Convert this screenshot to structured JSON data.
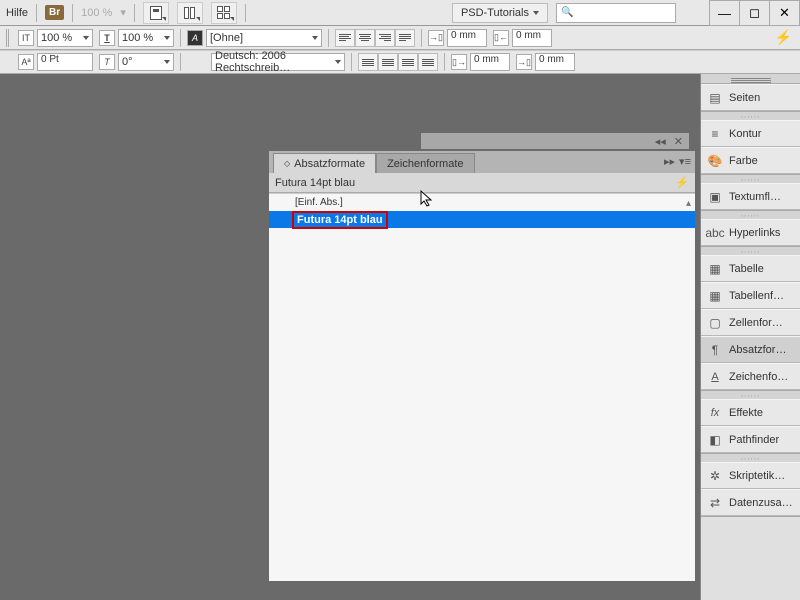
{
  "topbar": {
    "help": "Hilfe",
    "br": "Br",
    "zoom": "100 %",
    "workspace": "PSD-Tutorials",
    "search_placeholder": "🔍"
  },
  "window": {
    "min": "—",
    "max": "◻",
    "close": "✕"
  },
  "ctrl": {
    "horiz_scale": "100 %",
    "vert_scale": "100 %",
    "char_style": "[Ohne]",
    "language": "Deutsch: 2006 Rechtschreib…",
    "baseline": "0 Pt",
    "skew": "0°",
    "indent_left": "0 mm",
    "indent_right": "0 mm",
    "space_before": "0 mm",
    "space_after": "0 mm"
  },
  "panels": {
    "seiten": "Seiten",
    "kontur": "Kontur",
    "farbe": "Farbe",
    "textumfl": "Textumfl…",
    "hyperlinks": "Hyperlinks",
    "tabelle": "Tabelle",
    "tabellenf": "Tabellenf…",
    "zellenfor": "Zellenfor…",
    "absatzfor": "Absatzfor…",
    "zeichenfo": "Zeichenfo…",
    "effekte": "Effekte",
    "pathfinder": "Pathfinder",
    "skriptetik": "Skriptetik…",
    "datenzusa": "Datenzusa…"
  },
  "float": {
    "tab1": "Absatzformate",
    "tab2": "Zeichenformate",
    "current": "Futura 14pt blau",
    "rows": [
      "[Einf. Abs.]",
      "Futura 14pt blau"
    ]
  }
}
